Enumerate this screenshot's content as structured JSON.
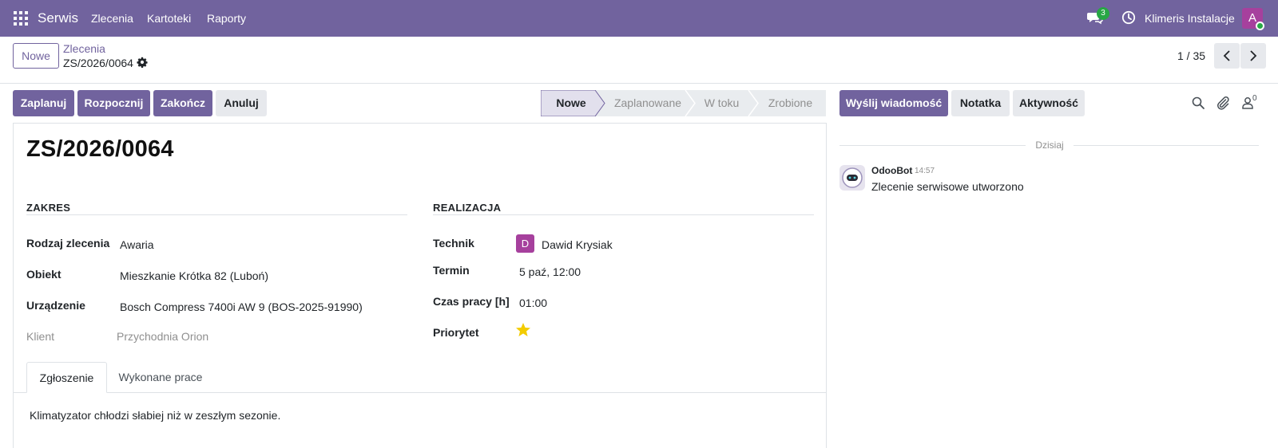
{
  "navbar": {
    "app_name": "Serwis",
    "menus": [
      "Zlecenia",
      "Kartoteki",
      "Raporty"
    ],
    "chat_badge": "3",
    "company": "Klimeris Instalacje",
    "avatar_initial": "A",
    "color": "#71639e"
  },
  "control": {
    "new_button": "Nowe",
    "breadcrumb_parent": "Zlecenia",
    "breadcrumb_current": "ZS/2026/0064",
    "pager": "1 / 35"
  },
  "actions": {
    "plan": "Zaplanuj",
    "start": "Rozpocznij",
    "finish": "Zakończ",
    "cancel": "Anuluj"
  },
  "statusbar": {
    "stages": [
      "Nowe",
      "Zaplanowane",
      "W toku",
      "Zrobione"
    ],
    "current": "Nowe"
  },
  "form": {
    "title": "ZS/2026/0064",
    "group_scope": "ZAKRES",
    "group_execution": "REALIZACJA",
    "fields_left": [
      {
        "label": "Rodzaj zlecenia",
        "value": "Awaria"
      },
      {
        "label": "Obiekt",
        "value": "Mieszkanie Krótka 82 (Luboń)"
      },
      {
        "label": "Urządzenie",
        "value": "Bosch Compress 7400i AW 9 (BOS-2025-91990)"
      },
      {
        "label": "Klient",
        "value": "Przychodnia Orion"
      }
    ],
    "fields_right": [
      {
        "label": "Technik",
        "value": "Dawid Krysiak",
        "avatar": "D"
      },
      {
        "label": "Termin",
        "value": "5 paź, 12:00"
      },
      {
        "label": "Czas pracy [h]",
        "value": "01:00"
      },
      {
        "label": "Priorytet",
        "stars": 1
      }
    ]
  },
  "tabs": {
    "items": [
      "Zgłoszenie",
      "Wykonane prace"
    ],
    "active": "Zgłoszenie",
    "content": "Klimatyzator chłodzi słabiej niż w zeszłym sezonie."
  },
  "chatter": {
    "send_message": "Wyślij wiadomość",
    "note": "Notatka",
    "activity": "Aktywność",
    "followers_count": "0",
    "date_separator": "Dzisiaj",
    "messages": [
      {
        "author": "OdooBot",
        "time": "14:57",
        "body": "Zlecenie serwisowe utworzono"
      }
    ]
  }
}
